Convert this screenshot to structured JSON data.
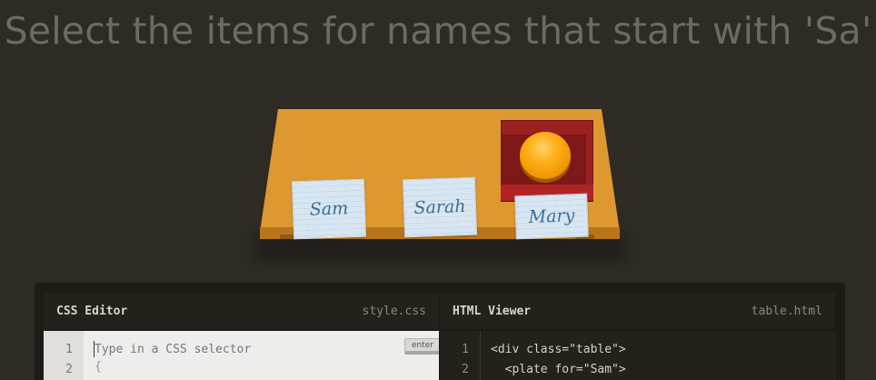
{
  "title": "Select the items for names that start with 'Sa'",
  "table": {
    "notes": [
      {
        "name": "Sam"
      },
      {
        "name": "Sarah"
      },
      {
        "name": "Mary"
      }
    ]
  },
  "css_editor": {
    "title": "CSS Editor",
    "filename": "style.css",
    "line_numbers": [
      "1",
      "2"
    ],
    "placeholder": "Type in a CSS selector",
    "brace": "{",
    "enter_label": "enter"
  },
  "html_viewer": {
    "title": "HTML Viewer",
    "filename": "table.html",
    "line_numbers": [
      "1",
      "2"
    ],
    "lines": [
      "<div class=\"table\">",
      "  <plate for=\"Sam\">"
    ]
  },
  "colors": {
    "background": "#2e2a24",
    "table": "#dd9830",
    "plate": "#9b2020",
    "orange": "#ffae1a",
    "note": "#d8e6f2"
  }
}
